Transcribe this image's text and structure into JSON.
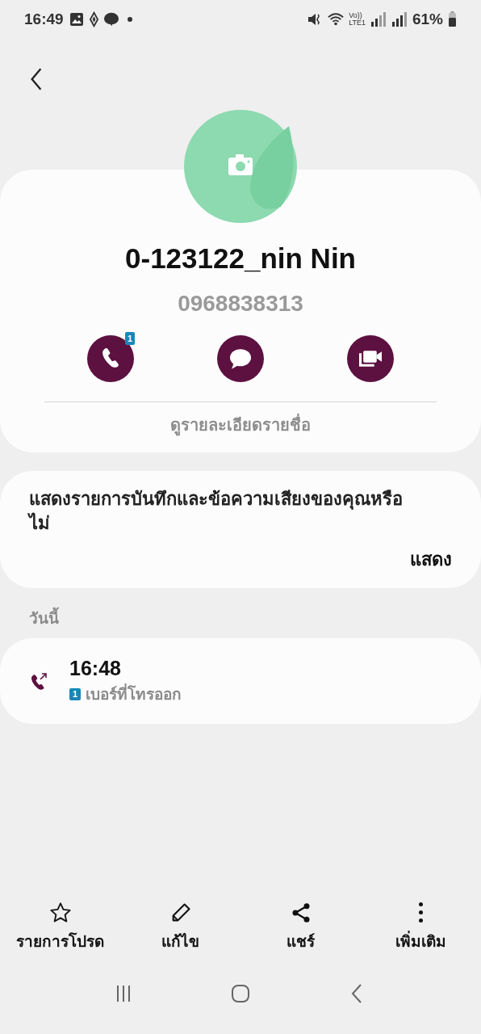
{
  "status_bar": {
    "time": "16:49",
    "volte": "Vo))",
    "network": "LTE1",
    "battery": "61%"
  },
  "contact": {
    "name": "0-123122_nin Nin",
    "number": "0968838313"
  },
  "actions": [
    {
      "kind": "call",
      "badge": "1"
    },
    {
      "kind": "message"
    },
    {
      "kind": "video"
    }
  ],
  "details_link": "ดูรายละเอียดรายชื่อ",
  "recording_prompt": {
    "text": "แสดงรายการบันทึกและข้อความเสียงของคุณหรือไม่",
    "button": "แสดง"
  },
  "history": {
    "heading": "วันนี้",
    "entries": [
      {
        "kind": "outgoing",
        "time": "16:48",
        "sim": "1",
        "label": "เบอร์ที่โทรออก"
      }
    ]
  },
  "bottom_actions": [
    {
      "kind": "favorite",
      "label": "รายการโปรด"
    },
    {
      "kind": "edit",
      "label": "แก้ไข"
    },
    {
      "kind": "share",
      "label": "แชร์"
    },
    {
      "kind": "more",
      "label": "เพิ่มเติม"
    }
  ]
}
